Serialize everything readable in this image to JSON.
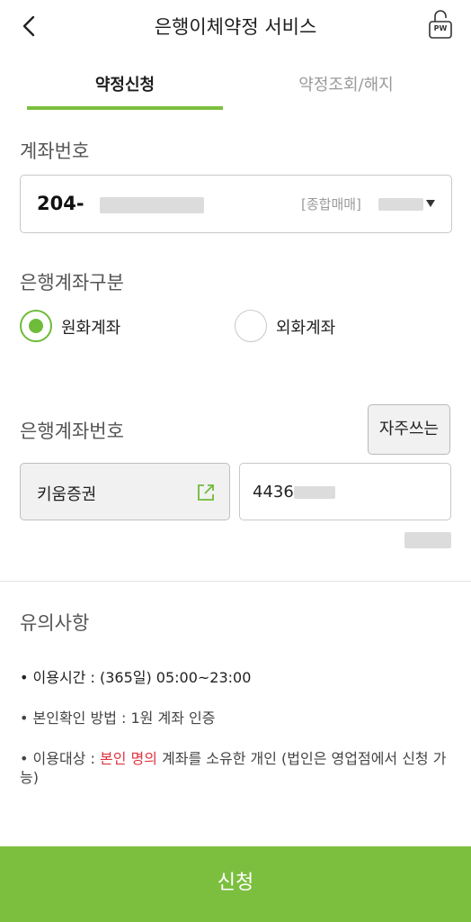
{
  "header": {
    "title": "은행이체약정 서비스",
    "pw_label": "PW"
  },
  "tabs": {
    "active": "약정신청",
    "inactive": "약정조회/해지"
  },
  "account": {
    "label": "계좌번호",
    "number_prefix": "204-",
    "type": "[종합매매]"
  },
  "bank_type": {
    "label": "은행계좌구분",
    "options": [
      "원화계좌",
      "외화계좌"
    ],
    "selected": "원화계좌"
  },
  "bank_account": {
    "label": "은행계좌번호",
    "favorites_button": "자주쓰는",
    "bank_name": "키움증권",
    "number_prefix": "4436"
  },
  "notes": {
    "title": "유의사항",
    "items": [
      "• 이용시간 : (365일) 05:00~23:00",
      "• 본인확인 방법 : 1원 계좌 인증"
    ],
    "item3_prefix": "• 이용대상 : ",
    "item3_highlight": "본인 명의",
    "item3_suffix": " 계좌를 소유한 개인 (법인은 영업점에서 신청 가능)"
  },
  "colors": {
    "accent": "#7cbf3f",
    "highlight_red": "#e0343f"
  },
  "submit_label": "신청"
}
